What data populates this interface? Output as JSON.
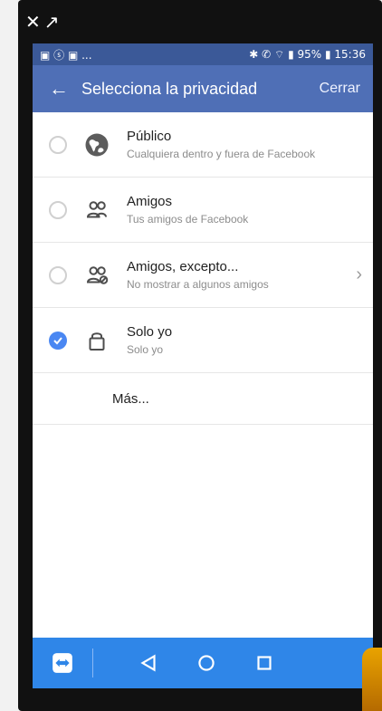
{
  "status_bar": {
    "left": "▣ ⓢ ▣ ...",
    "right": "✱ ✆ ⌔ ▮ 95% ▮ 15:36"
  },
  "header": {
    "title": "Selecciona la privacidad",
    "action": "Cerrar"
  },
  "options": [
    {
      "label": "Público",
      "sub": "Cualquiera dentro y fuera de Facebook"
    },
    {
      "label": "Amigos",
      "sub": "Tus amigos de Facebook"
    },
    {
      "label": "Amigos, excepto...",
      "sub": "No mostrar a algunos amigos"
    },
    {
      "label": "Solo yo",
      "sub": "Solo yo"
    }
  ],
  "more": "Más...",
  "icons": {
    "back": "arrow-back",
    "globe": "globe",
    "friends": "friends",
    "friends_except": "friends-except",
    "lock": "lock",
    "check": "check"
  },
  "colors": {
    "appbar": "#4f6fb6",
    "status_bar": "#3b5998",
    "selected": "#4a87f2",
    "nav_bar": "#2f86e8"
  }
}
